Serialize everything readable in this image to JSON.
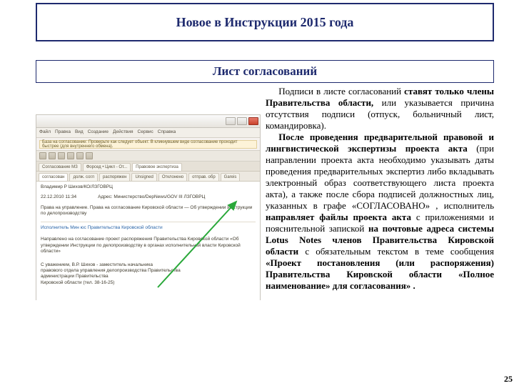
{
  "title": "Новое в Инструкции 2015 года",
  "subtitle": "Лист согласований",
  "page_number": "25",
  "screenshot": {
    "menubar": [
      "Файл",
      "Правка",
      "Вид",
      "Создание",
      "Действия",
      "Сервис",
      "Справка"
    ],
    "alert": "База на согласование: Проверьте как следует объект. В кликнувшем виде согласование проходит быстрее (для внутреннего обмена).",
    "tabs": [
      "Согласование МЗ",
      "Форсед • Цикл - От...",
      "Правовое экспертиза"
    ],
    "tabs2": [
      "согласован",
      "долж. согл",
      "распоряжен",
      "Unsigned",
      "Отклонено",
      "отправ. обр",
      "Gareis"
    ],
    "fields": {
      "author_label": "Владимир Р Шихов/КО/ЛЗГОВРЦ",
      "date": "22.12.2010 11:34",
      "dept": "Адрес: Министерство/DepNews/GOV III ЛЗГОВРЦ",
      "subj": "Права на управление. Права на согласование Кировской области — Об утверждении Инструкции по делопроизводству",
      "note": "Исполнитель Мин юс Правительства Кировской области",
      "heading": "Направлено на согласование проект распоряжения Правительства Кировской области «Об утверждении Инструкции по делопроизводству в органах исполнительной власти Кировской области»",
      "sign": "С уважением, В.Р. Шихов - заместитель начальника",
      "sign2": "правового отдела управления делопроизводства Правительства",
      "sign3": "администрации Правительства",
      "sign4": "Кировской области (тел. 38-16-25)"
    }
  },
  "body": {
    "p1_a": "Подписи в листе согласований ",
    "p1_b": "ставят только члены Правительства области, ",
    "p1_c": "или указывается причина отсутствия подписи (отпуск, больничный лист, командировка).",
    "p2_a": "После проведения предваритель­ной правовой и лингвистической экспертизы проекта акта ",
    "p2_b": "(при направлении проекта акта необходимо указывать даты проведения предвари­тельных экспертиз либо вкладывать электронный образ соответствующего листа проекта акта), а также после сбора подписей должностных лиц, указанных в графе «СОГЛАСОВАНО» , исполнитель ",
    "p2_c": "направляет файлы проекта акта ",
    "p2_d": "с приложениями и пояснительной запиской ",
    "p2_e": "на почтовые адреса системы Lotus Notes членов Правительства Кировской области ",
    "p2_f": "с обязательным текстом в теме сообщения ",
    "p2_g": "«Проект постановления (или распо­ряжения) Правительства Кировской области «Полное наименование» для согласования» ."
  }
}
